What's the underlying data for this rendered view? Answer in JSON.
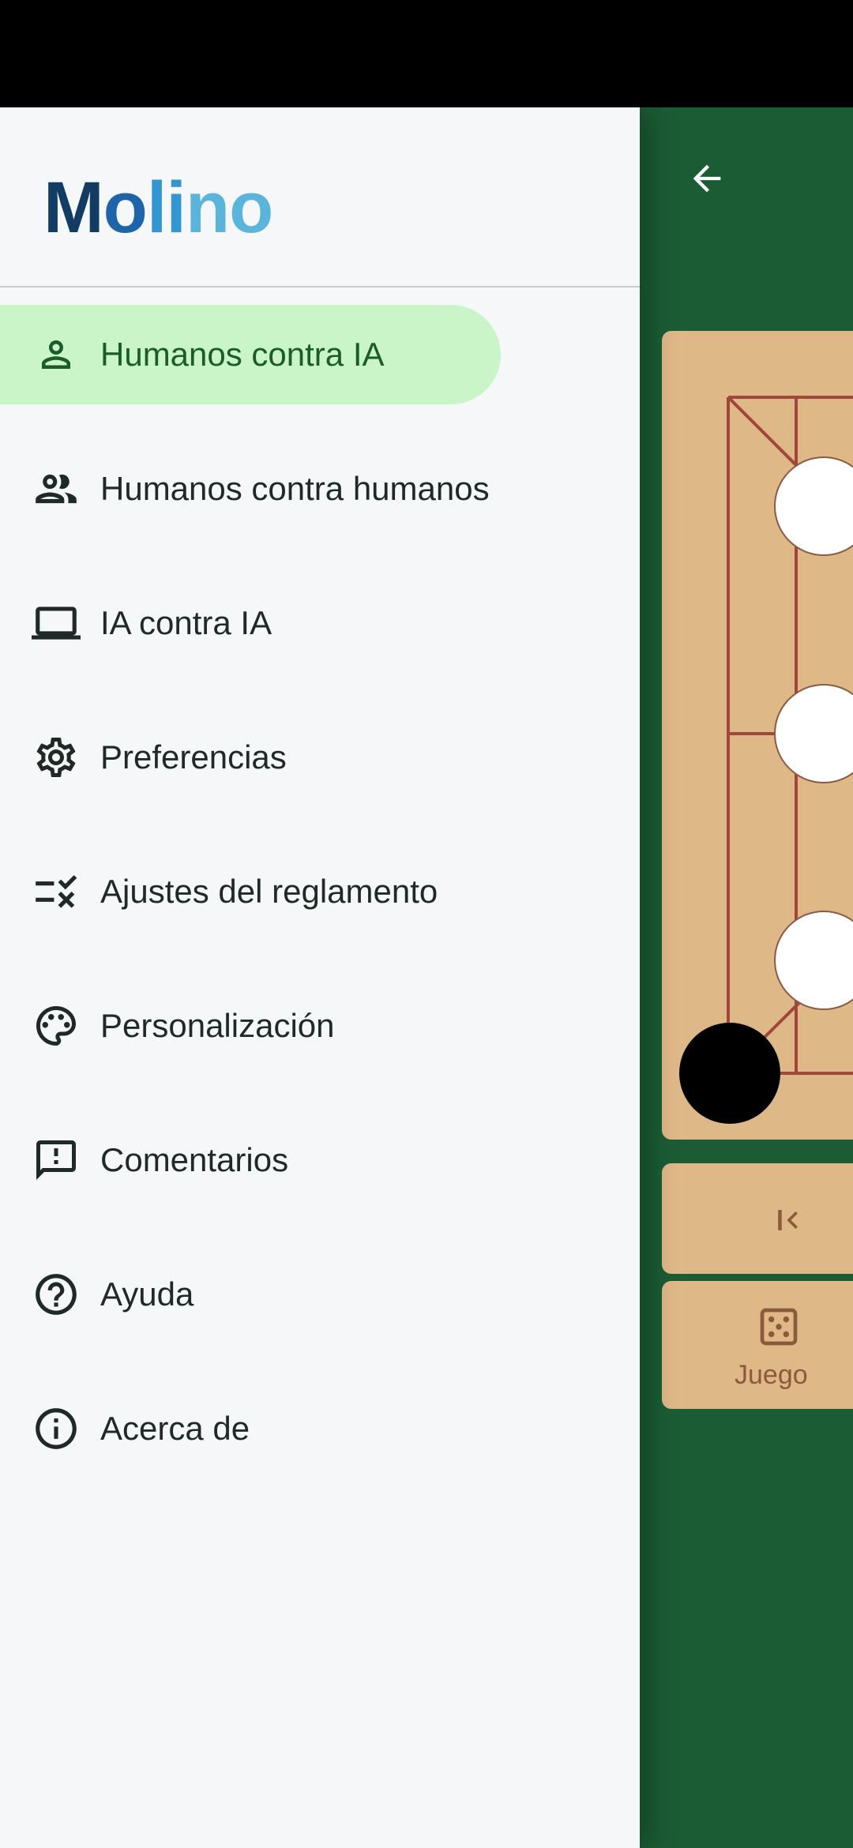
{
  "app": {
    "title_parts": [
      "M",
      "o",
      "li",
      "no"
    ]
  },
  "drawer": {
    "items": [
      {
        "label": "Humanos contra IA",
        "icon": "person-icon",
        "active": true
      },
      {
        "label": "Humanos contra humanos",
        "icon": "people-icon",
        "active": false
      },
      {
        "label": "IA contra IA",
        "icon": "laptop-icon",
        "active": false
      },
      {
        "label": "Preferencias",
        "icon": "gear-icon",
        "active": false
      },
      {
        "label": "Ajustes del reglamento",
        "icon": "rule-checklist-icon",
        "active": false
      },
      {
        "label": "Personalización",
        "icon": "palette-icon",
        "active": false
      },
      {
        "label": "Comentarios",
        "icon": "feedback-icon",
        "active": false
      },
      {
        "label": "Ayuda",
        "icon": "help-icon",
        "active": false
      },
      {
        "label": "Acerca de",
        "icon": "info-icon",
        "active": false
      }
    ]
  },
  "background_app": {
    "game_button_label": "Juego"
  },
  "colors": {
    "status_bar": "#000000",
    "app_green": "#1b5c35",
    "board": "#deb887",
    "active_item_bg": "#c9f5c9",
    "drawer_bg": "#f5f7f8"
  }
}
